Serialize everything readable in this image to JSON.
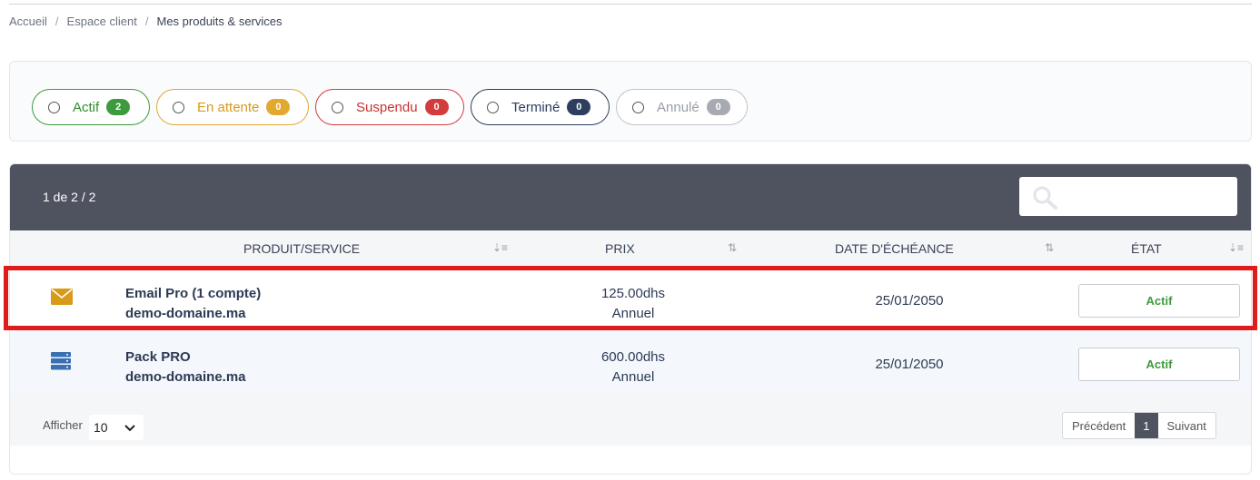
{
  "breadcrumb": [
    "Accueil",
    "Espace client",
    "Mes produits & services"
  ],
  "breadcrumb_separator": "/",
  "filters": [
    {
      "label": "Actif",
      "count": "2",
      "color": "#3d9a3d"
    },
    {
      "label": "En attente",
      "count": "0",
      "color": "#e3a830"
    },
    {
      "label": "Suspendu",
      "count": "0",
      "color": "#d23c3c"
    },
    {
      "label": "Terminé",
      "count": "0",
      "color": "#2d3e5e"
    },
    {
      "label": "Annulé",
      "count": "0",
      "color": "#a7abb1"
    }
  ],
  "table": {
    "count_label": "1 de 2 / 2",
    "search_placeholder": "",
    "columns": [
      "PRODUIT/SERVICE",
      "PRIX",
      "DATE D'ÉCHÉANCE",
      "ÉTAT"
    ],
    "rows": [
      {
        "icon": "envelope-icon",
        "product": "Email Pro (1 compte)",
        "domain": "demo-domaine.ma",
        "price": "125.00dhs",
        "cycle": "Annuel",
        "due_date": "25/01/2050",
        "status": "Actif"
      },
      {
        "icon": "server-icon",
        "product": "Pack PRO",
        "domain": "demo-domaine.ma",
        "price": "600.00dhs",
        "cycle": "Annuel",
        "due_date": "25/01/2050",
        "status": "Actif"
      }
    ]
  },
  "footer": {
    "show_label": "Afficher",
    "page_size": "10",
    "prev_label": "Précédent",
    "current_page": "1",
    "next_label": "Suivant"
  },
  "colors": {
    "header_bg": "#4f5360",
    "highlight": "#e01b1b",
    "status_active": "#3d9a3d"
  }
}
